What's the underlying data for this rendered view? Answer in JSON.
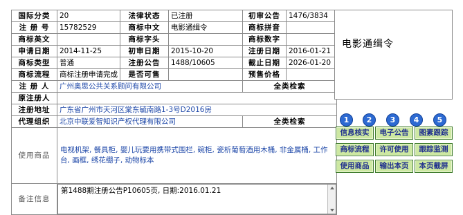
{
  "info": {
    "intl_class_label": "国际分类",
    "intl_class_value": "20",
    "legal_status_label": "法律状态",
    "legal_status_value": "已注册",
    "prelim_pub_label": "初审公告",
    "prelim_pub_value": "1476/3834",
    "reg_no_label": "注 册 号",
    "reg_no_value": "15782529",
    "mark_cn_label": "商标中文",
    "mark_cn_value": "电影通缉令",
    "mark_pinyin_label": "商标拼音",
    "mark_pinyin_value": "",
    "mark_en_label": "商标英文",
    "mark_en_value": "",
    "mark_initial_label": "商标字头",
    "mark_initial_value": "",
    "mark_digit_label": "商标数字",
    "mark_digit_value": "",
    "apply_date_label": "申请日期",
    "apply_date_value": "2014-11-25",
    "prelim_date_label": "初审日期",
    "prelim_date_value": "2015-10-20",
    "reg_date_label": "注册日期",
    "reg_date_value": "2016-01-21",
    "type_label": "商标类型",
    "type_value": "普通",
    "reg_pub_label": "注册公告",
    "reg_pub_value": "1488/10605",
    "expire_label": "截止日期",
    "expire_value": "2026-01-20",
    "process_label": "商标流程",
    "process_value": "商标注册申请完成",
    "shared_label": "是否可售",
    "shared_value": "",
    "presale_label": "预售价格",
    "presale_value": "",
    "registrant_label": "注 册 人",
    "registrant_value": "广州奥思公共关系顾问有限公司",
    "full_search": "全类检索",
    "orig_registrant_label": "原注册人",
    "orig_registrant_value": "",
    "address_label": "注册地址",
    "address_value": "广东省广州市天河区棠东毓南路1-3号D2016房",
    "agent_label": "代理组织",
    "agent_value": "北京中联爱智知识产权代理有限公司",
    "full_search2": "全类检索",
    "usage_label": "使用商品",
    "usage_value": "电视机架, 餐具柜, 婴儿玩要用携带式围栏, 碗柜, 瓷析葡萄酒用木桶, 非金属桶, 工作台, 画框, 绣花绷子, 动物标本",
    "notes_label": "备注信息",
    "notes_value": "第1488期注册公告P10605页, 日期:2016.01.21"
  },
  "preview": {
    "mark_text": "电影通缉令"
  },
  "numbers": [
    "1",
    "2",
    "3",
    "4",
    "5"
  ],
  "buttons": {
    "info_check": "信息核实",
    "e_announce": "电子公告",
    "image_track": "图素跟踪",
    "mark_process": "商标流程",
    "license_use": "许可使用",
    "track_monitor": "跟踪监测",
    "use_goods": "使用商品",
    "export_page": "输出本页",
    "screenshot_page": "本页截屏"
  },
  "colors": {
    "accent_blue": "#1d47a8",
    "button_green": "#cde8a2",
    "number_blue": "#2d6ad2"
  }
}
